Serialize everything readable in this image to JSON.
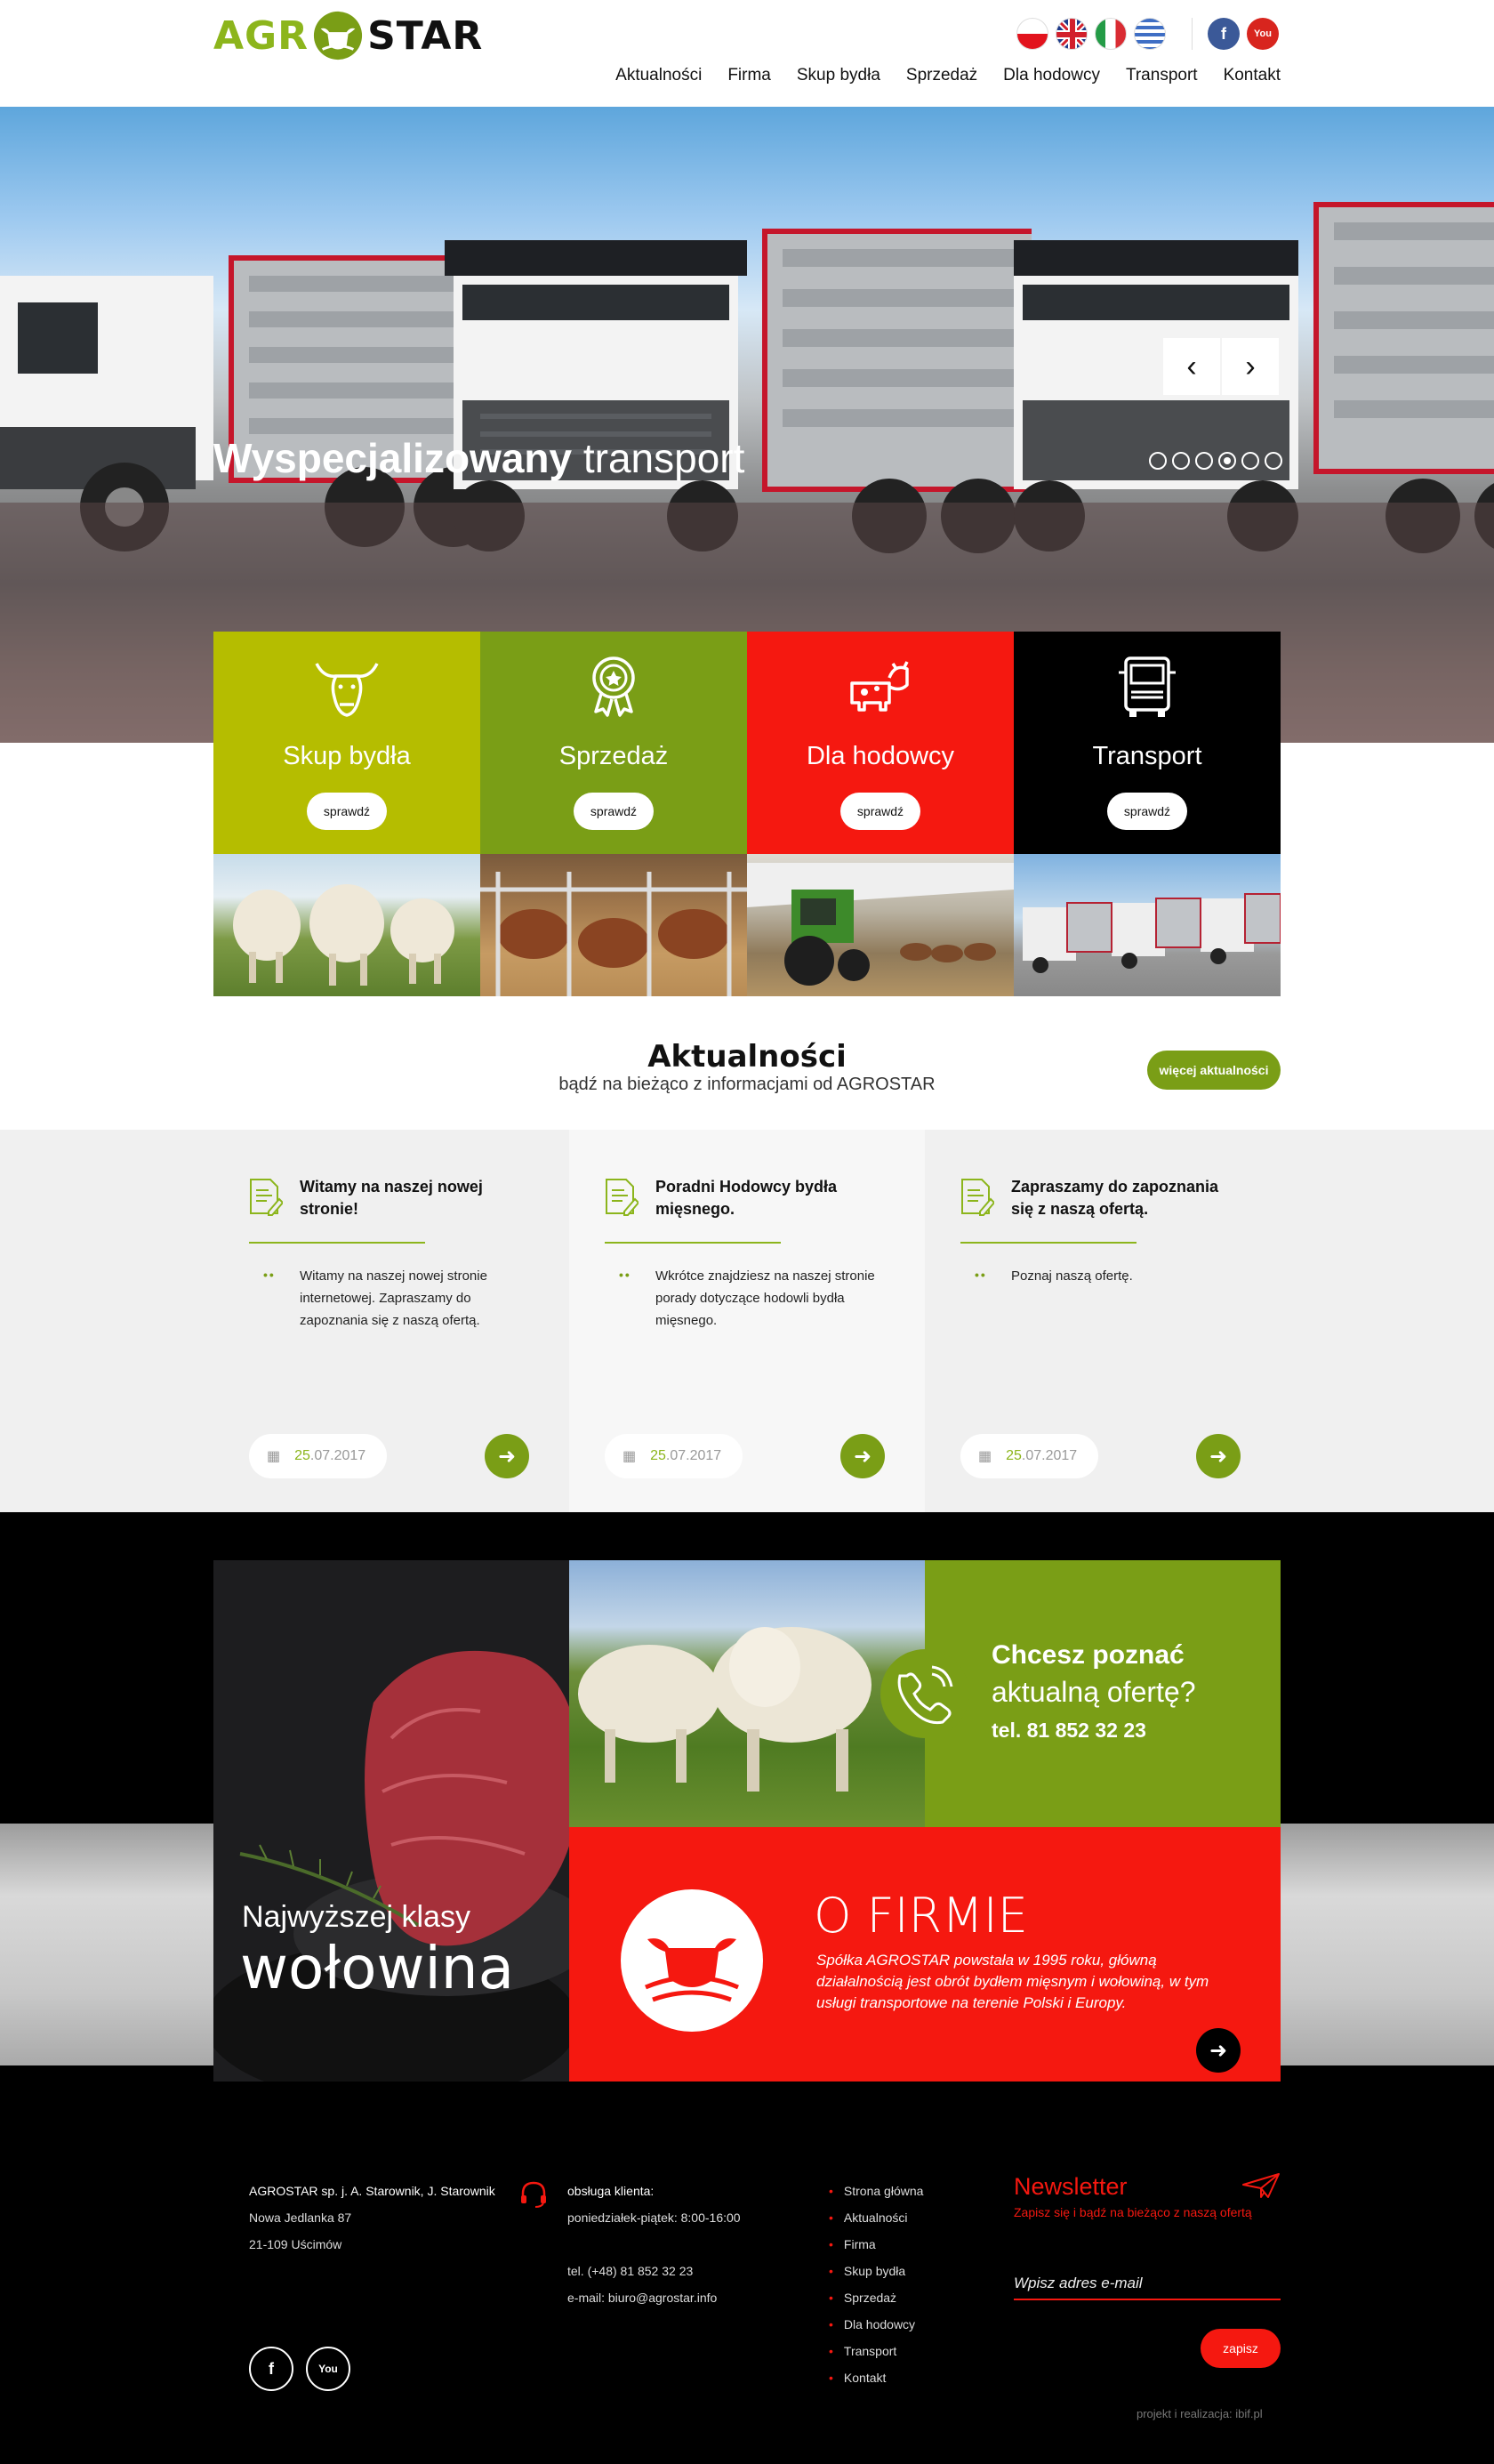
{
  "brand": {
    "logo_left": "AGR",
    "logo_right": "STAR"
  },
  "header": {
    "languages": [
      "pl",
      "en",
      "it",
      "gr"
    ],
    "social": [
      "facebook",
      "youtube"
    ],
    "nav": [
      "Aktualności",
      "Firma",
      "Skup bydła",
      "Sprzedaż",
      "Dla hodowcy",
      "Transport",
      "Kontakt"
    ]
  },
  "hero": {
    "title_bold": "Wyspecjalizowany",
    "title_light": "transport",
    "slides": 6,
    "active_slide": 4
  },
  "tiles": [
    {
      "label": "Skup bydła",
      "button": "sprawdź",
      "color": "#b5bd00",
      "icon": "bull-head-icon"
    },
    {
      "label": "Sprzedaż",
      "button": "sprawdź",
      "color": "#7a9e16",
      "icon": "award-badge-icon"
    },
    {
      "label": "Dla hodowcy",
      "button": "sprawdź",
      "color": "#f51810",
      "icon": "cow-icon"
    },
    {
      "label": "Transport",
      "button": "sprawdź",
      "color": "#000000",
      "icon": "truck-icon"
    }
  ],
  "news": {
    "title": "Aktualności",
    "subtitle": "bądź na bieżąco z informacjami od AGROSTAR",
    "more_button": "więcej aktualności",
    "items": [
      {
        "title": "Witamy na naszej nowej stronie!",
        "text": "Witamy na naszej nowej stronie internetowej. Zapraszamy do zapoznania się z naszą ofertą.",
        "date_day": "25",
        "date_rest": ".07.2017"
      },
      {
        "title": "Poradni Hodowcy bydła mięsnego.",
        "text": "Wkrótce znajdziesz na naszej stronie porady dotyczące hodowli bydła mięsnego.",
        "date_day": "25",
        "date_rest": ".07.2017"
      },
      {
        "title": "Zapraszamy do zapoznania się z naszą ofertą.",
        "text": "Poznaj naszą ofertę.",
        "date_day": "25",
        "date_rest": ".07.2017"
      }
    ]
  },
  "promo": {
    "meat_line1": "Najwyższej klasy",
    "meat_line2": "wołowina",
    "offer_line1": "Chcesz poznać",
    "offer_line2": "aktualną ofertę?",
    "offer_phone": "tel. 81 852 32 23",
    "about_title": "O FIRMIE",
    "about_text": "Spółka AGROSTAR powstała w 1995 roku, główną działalnością jest obrót bydłem mięsnym i wołowiną, w tym usługi transportowe na terenie Polski i Europy."
  },
  "footer": {
    "company": [
      "AGROSTAR sp. j. A. Starownik, J. Starownik",
      "Nowa Jedlanka 87",
      "21-109 Uścimów"
    ],
    "service_title": "obsługa klienta:",
    "service_hours": "poniedziałek-piątek: 8:00-16:00",
    "phone": "tel. (+48) 81 852 32 23",
    "email": "e-mail: biuro@agrostar.info",
    "links": [
      "Strona główna",
      "Aktualności",
      "Firma",
      "Skup bydła",
      "Sprzedaż",
      "Dla hodowcy",
      "Transport",
      "Kontakt"
    ],
    "newsletter_title": "Newsletter",
    "newsletter_sub": "Zapisz się i bądź na bieżąco z naszą ofertą",
    "newsletter_placeholder": "Wpisz adres e-mail",
    "newsletter_button": "zapisz",
    "credit": "projekt i realizacja: ibif.pl"
  }
}
